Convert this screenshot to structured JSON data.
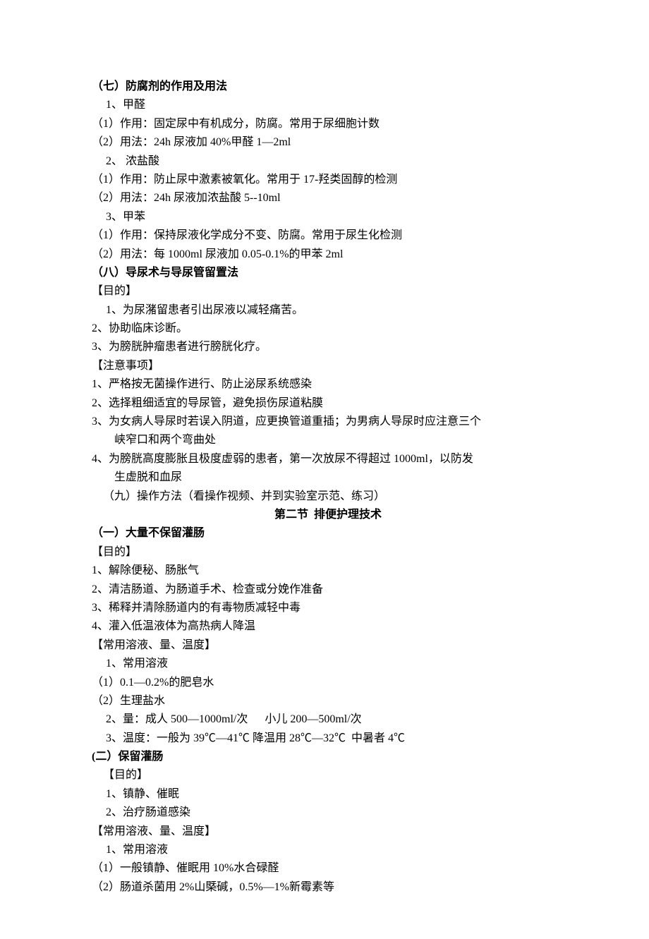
{
  "lines": [
    {
      "text": "（七）防腐剂的作用及用法",
      "bold": true
    },
    {
      "text": " 1、甲醛",
      "indent": 1
    },
    {
      "text": "（1）作用：固定尿中有机成分，防腐。常用于尿细胞计数"
    },
    {
      "text": "（2）用法：24h 尿液加 40%甲醛 1—2ml"
    },
    {
      "text": " 2、 浓盐酸",
      "indent": 1
    },
    {
      "text": "（1）作用：防止尿中激素被氧化。常用于 17-羟类固醇的检测"
    },
    {
      "text": "（2）用法：24h 尿液加浓盐酸 5--10ml"
    },
    {
      "text": " 3、甲苯",
      "indent": 1
    },
    {
      "text": "（1）作用：保持尿液化学成分不变、防腐。常用于尿生化检测"
    },
    {
      "text": "（2）用法：每 1000ml 尿液加 0.05-0.1%的甲苯 2ml"
    },
    {
      "text": "（八）导尿术与导尿管留置法",
      "bold": true
    },
    {
      "text": "【目的】"
    },
    {
      "text": " 1、为尿潴留患者引出尿液以减轻痛苦。",
      "indent": 1
    },
    {
      "text": "2、协助临床诊断。"
    },
    {
      "text": "3、为膀胱肿瘤患者进行膀胱化疗。"
    },
    {
      "text": "【注意事项】"
    },
    {
      "text": "1、严格按无菌操作进行、防止泌尿系统感染"
    },
    {
      "text": "2、选择粗细适宜的导尿管，避免损伤尿道粘膜"
    },
    {
      "text": "3、为女病人导尿时若误入阴道，应更换管道重插；为男病人导尿时应注意三个"
    },
    {
      "text": "峡窄口和两个弯曲处",
      "indent": 2
    },
    {
      "text": "4、为膀胱高度膨胀且极度虚弱的患者，第一次放尿不得超过 1000ml，以防发"
    },
    {
      "text": "生虚脱和血尿",
      "indent": 2
    },
    {
      "text": "（九）操作方法（看操作视频、并到实验室示范、练习）",
      "indent": 1
    },
    {
      "text": "第二节  排便护理技术",
      "bold": true,
      "center": true
    },
    {
      "text": "（一）大量不保留灌肠",
      "bold": true
    },
    {
      "text": "【目的】"
    },
    {
      "text": "1、解除便秘、肠胀气"
    },
    {
      "text": "2、清洁肠道、为肠道手术、检查或分娩作准备"
    },
    {
      "text": "3、稀释并清除肠道内的有毒物质减轻中毒"
    },
    {
      "text": "4、灌入低温液体为高热病人降温"
    },
    {
      "text": "【常用溶液、量、温度】"
    },
    {
      "text": " 1、常用溶液",
      "indent": 1
    },
    {
      "text": "（1）0.1—0.2%的肥皂水"
    },
    {
      "text": "（2）生理盐水"
    },
    {
      "text": " 2、量：成人 500—1000ml/次      小儿 200—500ml/次",
      "indent": 1
    },
    {
      "text": " 3、温度：一般为 39℃—41℃  降温用 28℃—32℃  中暑者 4℃",
      "indent": 1
    },
    {
      "text": "(二）保留灌肠",
      "bold": true
    },
    {
      "text": "【目的】",
      "indent": 1
    },
    {
      "text": " 1、镇静、催眠",
      "indent": 1
    },
    {
      "text": " 2、治疗肠道感染",
      "indent": 1
    },
    {
      "text": "【常用溶液、量、温度】"
    },
    {
      "text": " 1、常用溶液",
      "indent": 1
    },
    {
      "text": "（1）一般镇静、催眠用 10%水合碌醛"
    },
    {
      "text": "（2）肠道杀菌用 2%山槩碱，0.5%—1%新霉素等"
    }
  ]
}
